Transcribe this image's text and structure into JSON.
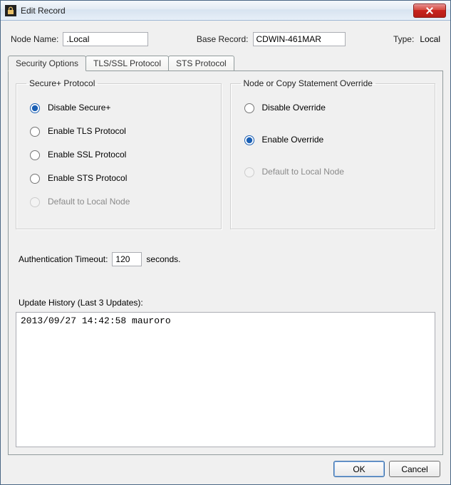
{
  "window": {
    "title": "Edit Record"
  },
  "header": {
    "node_name_label": "Node Name:",
    "node_name_value": ".Local",
    "base_record_label": "Base Record:",
    "base_record_value": "CDWIN-461MAR",
    "type_label": "Type:",
    "type_value": "Local"
  },
  "tabs": [
    {
      "id": "security",
      "label": "Security Options",
      "active": true
    },
    {
      "id": "tls",
      "label": "TLS/SSL Protocol",
      "active": false
    },
    {
      "id": "sts",
      "label": "STS Protocol",
      "active": false
    }
  ],
  "secure_protocol": {
    "legend": "Secure+ Protocol",
    "options": {
      "disable": "Disable Secure+",
      "tls": "Enable TLS Protocol",
      "ssl": "Enable SSL Protocol",
      "sts": "Enable STS Protocol",
      "default": "Default to Local Node"
    },
    "selected": "disable",
    "default_disabled": true
  },
  "override": {
    "legend": "Node or Copy Statement Override",
    "options": {
      "disable": "Disable Override",
      "enable": "Enable Override",
      "default": "Default to Local Node"
    },
    "selected": "enable",
    "default_disabled": true
  },
  "auth": {
    "label": "Authentication Timeout:",
    "value": "120",
    "suffix": "seconds."
  },
  "history": {
    "label": "Update History (Last 3 Updates):",
    "content": "2013/09/27 14:42:58 mauroro"
  },
  "buttons": {
    "ok": "OK",
    "cancel": "Cancel"
  }
}
